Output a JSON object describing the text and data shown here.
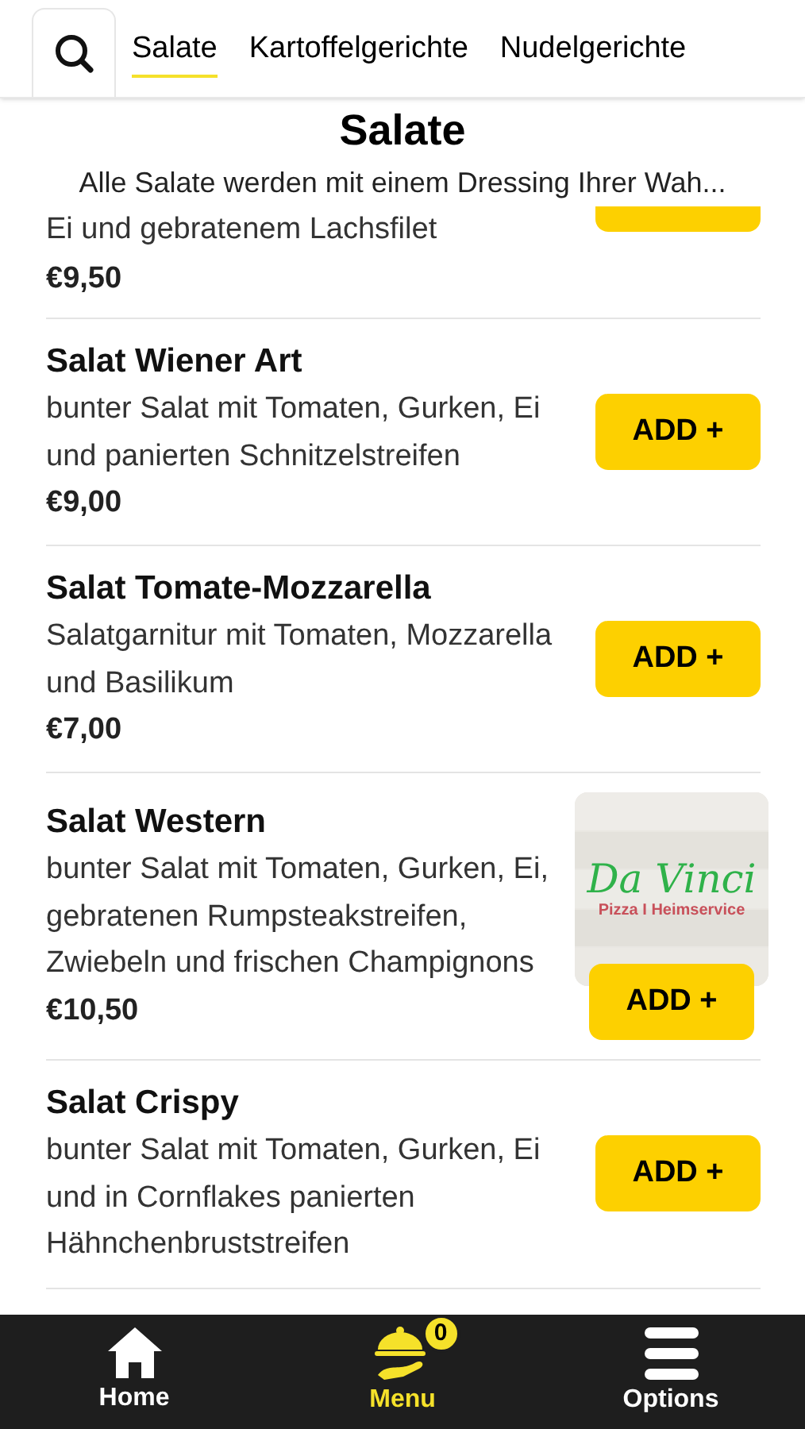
{
  "tabs": [
    {
      "label": "Salate",
      "selected": true
    },
    {
      "label": "Kartoffelgerichte",
      "selected": false
    },
    {
      "label": "Nudelgerichte",
      "selected": false
    }
  ],
  "category": {
    "title": "Salate",
    "subtitle": "Alle Salate werden mit einem Dressing Ihrer Wah..."
  },
  "items": [
    {
      "kind": "partial",
      "description": "Ei und gebratenem Lachsfilet",
      "price": "€9,50"
    },
    {
      "kind": "full",
      "name": "Salat Wiener Art",
      "description": "bunter Salat mit Tomaten, Gurken, Ei und panierten Schnitzelstreifen",
      "price": "€9,00",
      "button": "ADD +"
    },
    {
      "kind": "full",
      "name": "Salat Tomate-Mozzarella",
      "description": "Salatgarnitur mit Tomaten, Mozzarella und Basilikum",
      "price": "€7,00",
      "button": "ADD +"
    },
    {
      "name": "Salat Western",
      "description": "bunter Salat mit Tomaten, Gurken, Ei, gebratenen Rumpsteakstreifen, Zwiebeln und frischen Champignons",
      "price": "€10,50",
      "button": "ADD +",
      "logo": {
        "title": "Da Vinci",
        "subtitle": "Pizza I Heimservice"
      }
    },
    {
      "kind": "full",
      "name": "Salat Crispy",
      "description": "bunter Salat mit Tomaten, Gurken, Ei und in Cornflakes panierten Hähnchenbruststreifen",
      "button": "ADD +"
    }
  ],
  "nav": [
    {
      "kind": "home",
      "label": "Home",
      "selected": false
    },
    {
      "kind": "menu",
      "label": "Menu",
      "selected": true,
      "badge": "0"
    },
    {
      "kind": "options",
      "label": "Options",
      "selected": false
    }
  ]
}
